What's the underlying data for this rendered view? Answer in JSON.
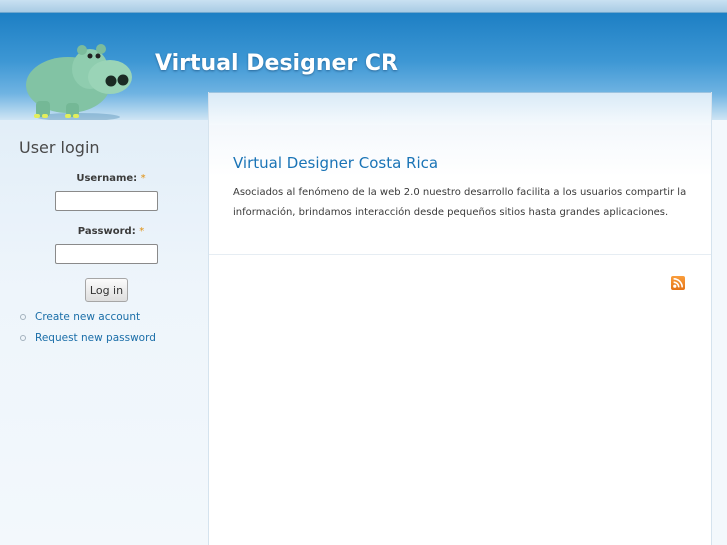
{
  "site": {
    "name": "Virtual Designer CR",
    "logo_icon": "hippo-logo"
  },
  "sidebar": {
    "title": "User login",
    "username_label": "Username:",
    "password_label": "Password:",
    "required_marker": "*",
    "username_value": "",
    "password_value": "",
    "login_button": "Log in",
    "links": [
      "Create new account",
      "Request new password"
    ]
  },
  "content": {
    "title": "Virtual Designer Costa Rica",
    "body": "Asociados al fenómeno de la web 2.0 nuestro desarrollo facilita a los usuarios compartir la información, brindamos interacción desde pequeños sitios hasta grandes aplicaciones.",
    "feed_icon": "rss-feed-icon"
  },
  "colors": {
    "header": "#2f8fd0",
    "link": "#1a6ea8",
    "title": "#1a74b6",
    "feed": "#f28a2a"
  }
}
